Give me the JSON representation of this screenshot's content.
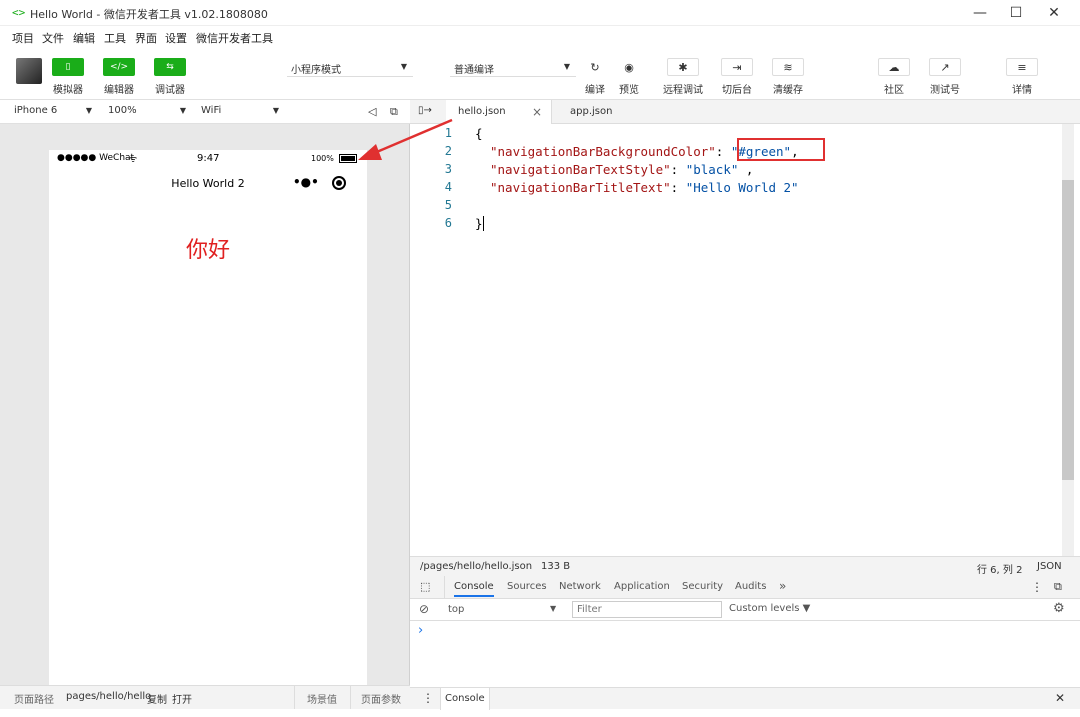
{
  "window": {
    "app_icon": "<>",
    "title": "Hello World - 微信开发者工具 v1.02.1808080",
    "minimize": "—",
    "maximize": "☐",
    "close": "✕"
  },
  "menu": [
    "项目",
    "文件",
    "编辑",
    "工具",
    "界面",
    "设置",
    "微信开发者工具"
  ],
  "toolbar": {
    "simulator": {
      "icon": "▯",
      "label": "模拟器"
    },
    "editor": {
      "icon": "</>",
      "label": "编辑器"
    },
    "debugger": {
      "icon": "⇆",
      "label": "调试器"
    },
    "mode_select": "小程序模式",
    "compile_select": "普通编译",
    "compile": {
      "icon": "↻",
      "label": "编译"
    },
    "preview": {
      "icon": "◉",
      "label": "预览"
    },
    "remote_debug": {
      "icon": "✱",
      "label": "远程调试"
    },
    "background": {
      "icon": "⇥",
      "label": "切后台"
    },
    "clear_cache": {
      "icon": "≋",
      "label": "清缓存"
    },
    "community": {
      "icon": "☁",
      "label": "社区"
    },
    "test_account": {
      "icon": "↗",
      "label": "测试号"
    },
    "details": {
      "icon": "≡",
      "label": "详情"
    }
  },
  "device_bar": {
    "device": "iPhone 6",
    "zoom": "100%",
    "network": "WiFi",
    "sound_icon": "◁",
    "popout_icon": "⧉"
  },
  "phone": {
    "signal": "●●●●● WeChat",
    "wifi_icon": "ᯤ",
    "time": "9:47",
    "battery": "100%",
    "nav_title": "Hello World 2",
    "menu_dots": "•●•",
    "greeting": "你好"
  },
  "sim_bottom": {
    "path_label": "页面路径",
    "path_value": "pages/hello/hello",
    "copy": "复制",
    "open": "打开",
    "scene": "场景值",
    "params": "页面参数"
  },
  "editor": {
    "toggle_icon": "▯→",
    "tabs": [
      {
        "label": "hello.json",
        "close": "×"
      },
      {
        "label": "app.json"
      }
    ],
    "lines": [
      {
        "no": "1",
        "text": "{"
      },
      {
        "no": "2",
        "key": "\"navigationBarBackgroundColor\"",
        "sep": ": ",
        "value": "\"#green\"",
        "tail": ","
      },
      {
        "no": "3",
        "key": "\"navigationBarTextStyle\"",
        "sep": ": ",
        "value": "\"black\"",
        "tail": " ,"
      },
      {
        "no": "4",
        "key": "\"navigationBarTitleText\"",
        "sep": ": ",
        "value": "\"Hello World 2\"",
        "tail": ""
      },
      {
        "no": "5",
        "text": ""
      },
      {
        "no": "6",
        "text": "}"
      }
    ]
  },
  "status": {
    "file_path": "/pages/hello/hello.json",
    "file_size": "133 B",
    "cursor": "行 6, 列 2",
    "language": "JSON"
  },
  "devtools": {
    "inspect_icon": "⬚",
    "tabs": [
      "Console",
      "Sources",
      "Network",
      "Application",
      "Security",
      "Audits"
    ],
    "more": "»",
    "menu_icon": "⋮",
    "dock_icon": "⧉",
    "clear_icon": "⊘",
    "context": "top",
    "context_caret": "▼",
    "filter_placeholder": "Filter",
    "levels": "Custom levels ▼",
    "gear_icon": "⚙",
    "prompt": "›",
    "drawer_menu": "⋮",
    "drawer_tab": "Console",
    "drawer_close": "✕"
  }
}
